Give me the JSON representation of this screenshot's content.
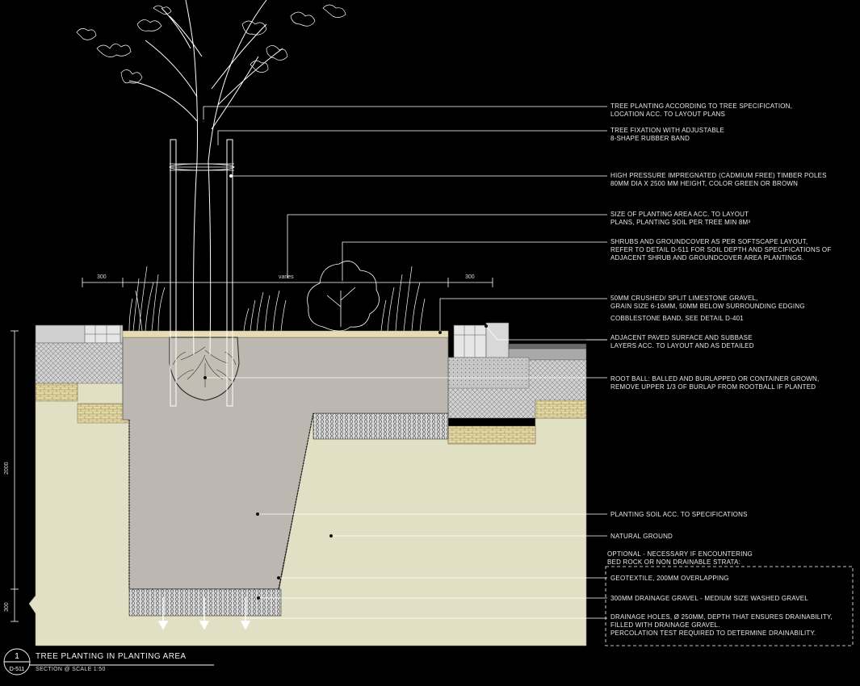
{
  "annotations": [
    {
      "id": "tree",
      "lines": [
        "TREE PLANTING ACCORDING TO TREE SPECIFICATION,",
        "LOCATION ACC. TO LAYOUT PLANS"
      ]
    },
    {
      "id": "fixation",
      "lines": [
        "TREE FIXATION WITH ADJUSTABLE",
        "8-SHAPE RUBBER BAND"
      ]
    },
    {
      "id": "poles",
      "lines": [
        "HIGH PRESSURE IMPREGNATED (CADMIUM FREE) TIMBER POLES",
        "80MM DIA X 2500 MM HEIGHT, COLOR GREEN OR BROWN"
      ]
    },
    {
      "id": "area-size",
      "lines": [
        "SIZE OF PLANTING AREA ACC. TO LAYOUT",
        "PLANS, PLANTING SOIL PER TREE MIN 8M³"
      ]
    },
    {
      "id": "shrubs",
      "lines": [
        "SHRUBS AND GROUNDCOVER AS PER SOFTSCAPE LAYOUT,",
        "REFER TO DETAIL D-511 FOR SOIL DEPTH AND SPECIFICATIONS OF",
        "ADJACENT SHRUB AND GROUNDCOVER AREA PLANTINGS."
      ]
    },
    {
      "id": "gravel",
      "lines": [
        "50mm CRUSHED/ SPLIT LIMESTONE GRAVEL,",
        "GRAIN SIZE 6-16MM, 50MM BELOW SURROUNDING EDGING"
      ]
    },
    {
      "id": "cobblestone",
      "lines": [
        "COBBLESTONE BAND, SEE DETAIL D-401"
      ]
    },
    {
      "id": "paved",
      "lines": [
        "ADJACENT PAVED SURFACE AND SUBBASE",
        "LAYERS ACC. TO LAYOUT AND AS DETAILED"
      ]
    },
    {
      "id": "rootball",
      "lines": [
        "ROOT BALL: BALLED AND BURLAPPED OR CONTAINER GROWN,",
        "REMOVE UPPER 1/3 OF BURLAP FROM ROOTBALL IF PLANTED"
      ]
    },
    {
      "id": "soil",
      "lines": [
        "PLANTING SOIL ACC. TO SPECIFICATIONS"
      ]
    },
    {
      "id": "ground",
      "lines": [
        "NATURAL GROUND"
      ]
    },
    {
      "id": "optional",
      "lines": [
        "OPTIONAL - NECESSARY IF ENCOUNTERING",
        "BED ROCK OR NON DRAINABLE STRATA:"
      ]
    },
    {
      "id": "geotextile",
      "lines": [
        "GEOTEXTILE, 200mm OVERLAPPING"
      ]
    },
    {
      "id": "drainage",
      "lines": [
        "300mm DRAINAGE GRAVEL - MEDIUM SIZE WASHED GRAVEL"
      ]
    },
    {
      "id": "holes",
      "lines": [
        "DRAINAGE HOLES, Ø 250mm, DEPTH THAT ENSURES DRAINABILITY,",
        "FILLED WITH DRAINAGE GRAVEL.",
        "PERCOLATION TEST REQUIRED TO DETERMINE DRAINABILITY."
      ]
    }
  ],
  "dimensions": {
    "left_offset": "300",
    "width": "varies",
    "right_offset": "300",
    "depth": "2000",
    "gravel_depth": "300"
  },
  "title": {
    "number": "1",
    "sheet": "D-511",
    "main": "TREE PLANTING IN PLANTING AREA",
    "sub": "SECTION @ SCALE 1:50"
  },
  "colors": {
    "background": "#000000",
    "natural_ground": "#e2e0c4",
    "planting_soil": "#bcb7b0",
    "concrete": "#cfcfcf",
    "gravel_top": "#e8dcb8",
    "lines": "#ffffff"
  }
}
